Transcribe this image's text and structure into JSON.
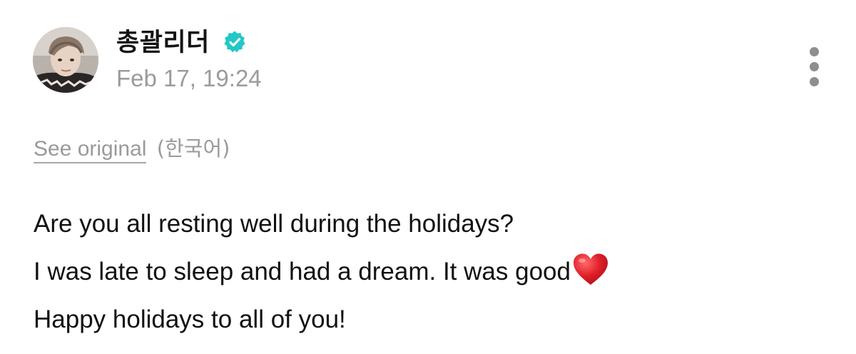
{
  "post": {
    "author": {
      "name": "총괄리더",
      "verified": true,
      "avatar_icon": "profile-photo"
    },
    "time": "Feb 17, 19:24",
    "menu_icon": "more-vertical-icon",
    "translation": {
      "see_original_label": "See original",
      "source_language": "(한국어)"
    },
    "body": {
      "lines": [
        "Are you all resting well during the holidays?",
        "I was late to sleep and had a dream. It was good",
        "Happy holidays to all of you!"
      ],
      "trailing_emoji": "red-heart-emoji"
    }
  },
  "colors": {
    "verified_badge": "#22c7c7",
    "muted_text": "#9b9b9b",
    "heart": "#e0202a"
  }
}
